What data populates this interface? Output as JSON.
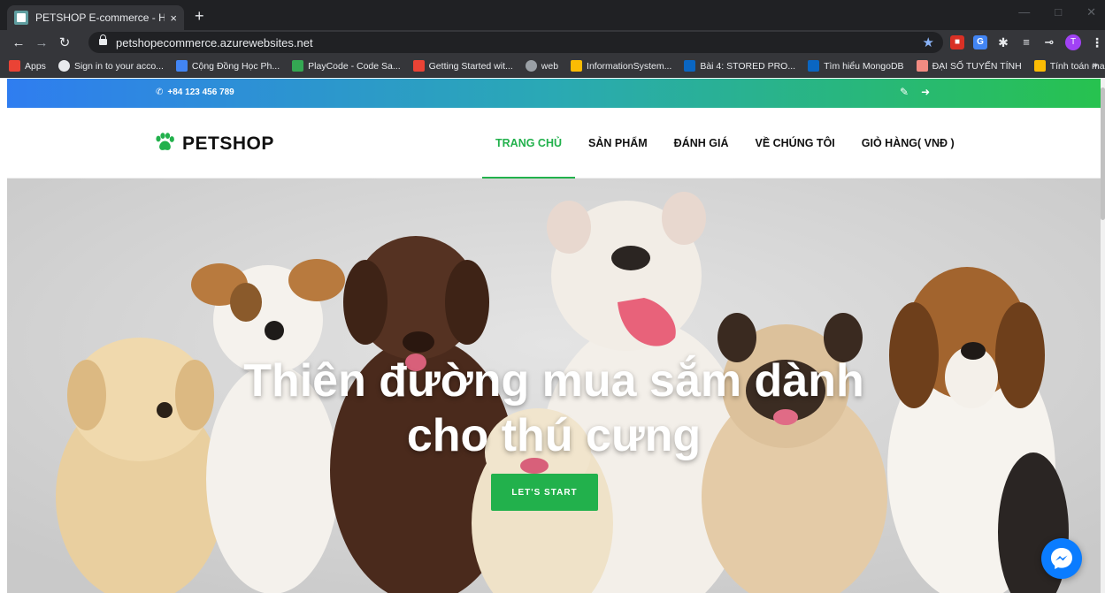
{
  "browser": {
    "tab_title": "PETSHOP E-commerce - HCMUE",
    "tab_close": "×",
    "new_tab": "+",
    "url": "petshopecommerce.azurewebsites.net",
    "profile_initial": "T",
    "bookmarks": [
      {
        "label": "Apps",
        "color": "#ea4335"
      },
      {
        "label": "Sign in to your acco...",
        "color": "#e8eaed"
      },
      {
        "label": "Cộng Đồng Học Ph...",
        "color": "#4285f4"
      },
      {
        "label": "PlayCode - Code Sa...",
        "color": "#34a853"
      },
      {
        "label": "Getting Started wit...",
        "color": "#ea4335"
      },
      {
        "label": "web",
        "color": "#9aa0a6"
      },
      {
        "label": "InformationSystem...",
        "color": "#fbbc04"
      },
      {
        "label": "Bài 4: STORED PRO...",
        "color": "#0a66c2"
      },
      {
        "label": "Tìm hiểu MongoDB",
        "color": "#0a66c2"
      },
      {
        "label": "ĐẠI SỐ TUYẾN TÍNH",
        "color": "#f28b82"
      },
      {
        "label": "Tính toán ma trận",
        "color": "#fbbc04"
      }
    ]
  },
  "site": {
    "phone": "+84 123 456 789",
    "logo_text": "PETSHOP",
    "nav": [
      {
        "label": "TRANG CHỦ",
        "active": true
      },
      {
        "label": "SẢN PHẨM",
        "active": false
      },
      {
        "label": "ĐÁNH GIÁ",
        "active": false
      },
      {
        "label": "VỀ CHÚNG TÔI",
        "active": false
      },
      {
        "label": "GIỎ HÀNG( VNĐ )",
        "active": false
      }
    ],
    "hero_title_line1": "Thiên đường mua sắm dành",
    "hero_title_line2": "cho thú cưng",
    "hero_button": "LET'S START",
    "colors": {
      "accent": "#22b14c",
      "gradient_start": "#2f7df0",
      "gradient_end": "#27c24f",
      "messenger": "#0a7cff"
    }
  }
}
